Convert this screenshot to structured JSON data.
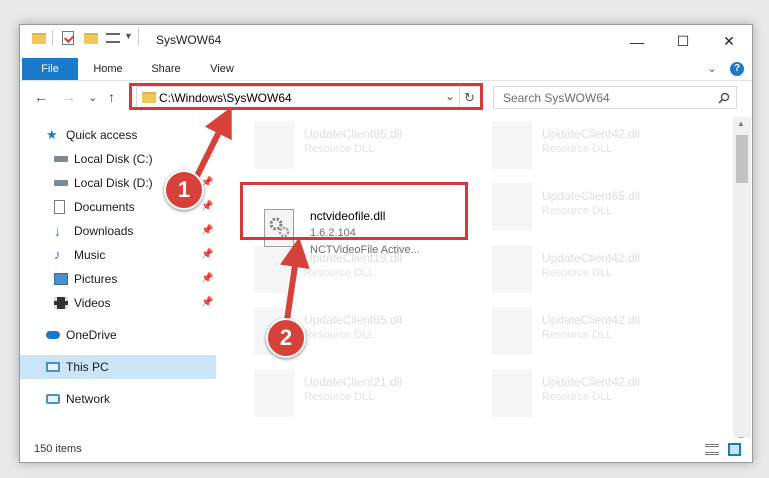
{
  "window": {
    "title": "SysWOW64",
    "minimize_glyph": "—",
    "maximize_glyph": "☐",
    "close_glyph": "✕"
  },
  "ribbon": {
    "tabs": [
      "File",
      "Home",
      "Share",
      "View"
    ],
    "expand_glyph": "⌄",
    "help_glyph": "?"
  },
  "address": {
    "path": "C:\\Windows\\SysWOW64",
    "dropdown_glyph": "⌄",
    "refresh_glyph": "↻"
  },
  "search": {
    "placeholder": "Search SysWOW64"
  },
  "nav_buttons": {
    "back": "←",
    "forward": "→",
    "recent": "⌄",
    "up": "↑"
  },
  "sidebar": {
    "items": [
      {
        "label": "Quick access",
        "icon": "star-icon"
      },
      {
        "label": "Local Disk (C:)",
        "icon": "drive-icon"
      },
      {
        "label": "Local Disk (D:)",
        "icon": "drive-icon"
      },
      {
        "label": "Documents",
        "icon": "documents-icon"
      },
      {
        "label": "Downloads",
        "icon": "download-icon"
      },
      {
        "label": "Music",
        "icon": "music-icon"
      },
      {
        "label": "Pictures",
        "icon": "pictures-icon"
      },
      {
        "label": "Videos",
        "icon": "videos-icon"
      },
      {
        "label": "OneDrive",
        "icon": "cloud-icon"
      },
      {
        "label": "This PC",
        "icon": "computer-icon"
      },
      {
        "label": "Network",
        "icon": "network-icon"
      }
    ]
  },
  "files": {
    "background": [
      {
        "name": "UpdateClient65.dll",
        "type": "Resource DLL"
      },
      {
        "name": "UpdateClient42.dll",
        "type": "Resource DLL"
      },
      {
        "name": "UpdateClient65.dll",
        "type": "Resource DLL"
      },
      {
        "name": "UpdateClient19.dll",
        "type": "Resource DLL"
      },
      {
        "name": "UpdateClient42.dll",
        "type": "Resource DLL"
      },
      {
        "name": "UpdateClient65.dll",
        "type": "Resource DLL"
      },
      {
        "name": "UpdateClient42.dll",
        "type": "Resource DLL"
      },
      {
        "name": "UpdateClient21.dll",
        "type": "Resource DLL"
      },
      {
        "name": "UpdateClient42.dll",
        "type": "Resource DLL"
      }
    ],
    "highlighted": {
      "name": "nctvideofile.dll",
      "version": "1.6.2.104",
      "description": "NCTVideoFile Active..."
    }
  },
  "status": {
    "count": "150 items"
  },
  "callouts": {
    "step1": "1",
    "step2": "2"
  },
  "colors": {
    "accent_blue": "#1979ca",
    "highlight_red": "#d13b3b",
    "callout_red": "#d6413a"
  }
}
